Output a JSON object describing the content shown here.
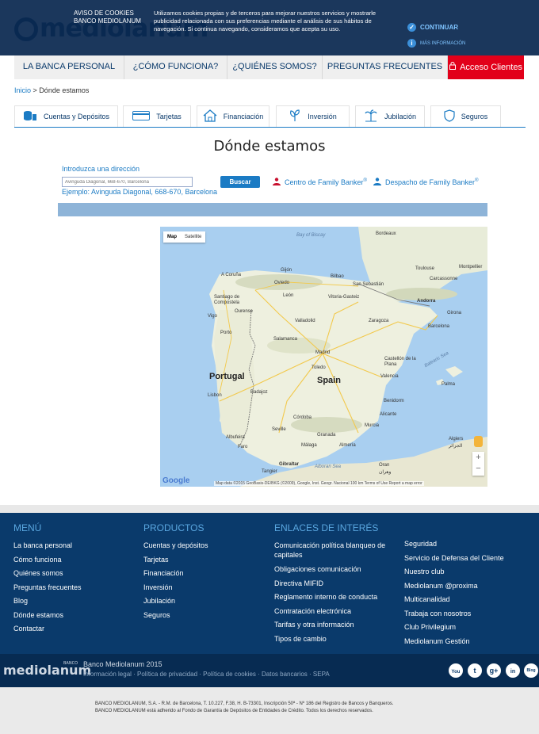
{
  "header": {
    "logo": "mediolanum"
  },
  "cookie": {
    "title_line1": "AVISO DE COOKIES",
    "title_line2": "BANCO MEDIOLANUM",
    "text": "Utilizamos cookies propias y de terceros para mejorar nuestros servicios y mostrarle publicidad relacionada con sus preferencias mediante el análisis de sus hábitos de navegación. Si continua navegando, consideramos que acepta su uso.",
    "continue": "CONTINUAR",
    "more_info": "MÁS INFORMACIÓN"
  },
  "nav": {
    "items": [
      "LA BANCA PERSONAL",
      "¿CÓMO FUNCIONA?",
      "¿QUIÉNES SOMOS?",
      "PREGUNTAS FRECUENTES"
    ],
    "acceso": "Acceso Clientes"
  },
  "breadcrumb": {
    "home": "Inicio",
    "sep": ">",
    "current": "Dónde estamos"
  },
  "tabs": [
    "Cuentas y Depósitos",
    "Tarjetas",
    "Financiación",
    "Inversión",
    "Jubilación",
    "Seguros"
  ],
  "page": {
    "title": "Dónde estamos"
  },
  "search": {
    "label": "Introduzca una dirección",
    "placeholder": "Avinguda Diagonal, 668-670, Barcelona",
    "example": "Ejemplo: Avinguda Diagonal, 668-670, Barcelona",
    "button": "Buscar",
    "legend_center": "Centro de Family Banker",
    "legend_office": "Despacho de Family Banker",
    "reg": "®"
  },
  "map": {
    "type_map": "Map",
    "type_satellite": "Satellite",
    "labels": {
      "bay": "Bay of Biscay",
      "bordeaux": "Bordeaux",
      "toulouse": "Toulouse",
      "montpellier": "Montpellier",
      "acoruna": "A Coruña",
      "gijon": "Gijón",
      "oviedo": "Oviedo",
      "bilbao": "Bilbao",
      "sansebastian": "San Sebastián",
      "carcassonne": "Carcassonne",
      "santiago": "Santiago de Compostela",
      "leon": "León",
      "vitoria": "Vitoria-Gasteiz",
      "andorra": "Andorra",
      "vigo": "Vigo",
      "ourense": "Ourense",
      "valladolid": "Valladolid",
      "zaragoza": "Zaragoza",
      "girona": "Girona",
      "porto": "Porto",
      "salamanca": "Salamanca",
      "barcelona": "Barcelona",
      "madrid": "Madrid",
      "toledo": "Toledo",
      "castellon": "Castellón de la Plana",
      "balearic": "Balearic Sea",
      "portugal": "Portugal",
      "spain": "Spain",
      "valencia": "Valencia",
      "palma": "Palma",
      "lisbon": "Lisbon",
      "badajoz": "Badajoz",
      "benidorm": "Benidorm",
      "alicante": "Alicante",
      "cordoba": "Córdoba",
      "murcia": "Murcia",
      "sevilla": "Seville",
      "granada": "Granada",
      "almeria": "Almería",
      "albufeira": "Albufeira",
      "faro": "Faro",
      "malaga": "Málaga",
      "algiers": "Algiers",
      "algiers_ar": "الجزائر",
      "gibraltar": "Gibraltar",
      "alboran": "Alboran Sea",
      "tangier": "Tangier",
      "oran": "Oran",
      "oran_ar": "وهران"
    },
    "zoom_in": "+",
    "zoom_out": "−",
    "google": "Google",
    "attribution": "Map data ©2015 GeoBasis-DE/BKG (©2009), Google, Inst. Geogr. Nacional   100 km   Terms of Use   Report a map error"
  },
  "footer": {
    "menu": {
      "title": "MENÚ",
      "links": [
        "La banca personal",
        "Cómo funciona",
        "Quiénes somos",
        "Preguntas frecuentes",
        "Blog",
        "Dónde estamos",
        "Contactar"
      ]
    },
    "products": {
      "title": "PRODUCTOS",
      "links": [
        "Cuentas y depósitos",
        "Tarjetas",
        "Financiación",
        "Inversión",
        "Jubilación",
        "Seguros"
      ]
    },
    "links": {
      "title": "ENLACES DE INTERÉS",
      "col1": [
        "Comunicación política blanqueo de capitales",
        "Obligaciones comunicación",
        "Directiva MIFID",
        "Reglamento interno de conducta",
        "Contratación electrónica",
        "Tarifas y otra información",
        "Tipos de cambio"
      ],
      "col2": [
        "Seguridad",
        "Servicio de Defensa del Cliente",
        "Nuestro club",
        "Mediolanum @proxima",
        "Multicanalidad",
        "Trabaja con nosotros",
        "Club Privilegium",
        "Mediolanum Gestión"
      ]
    },
    "logo": "mediolanum",
    "logo_small": "BANCO",
    "copyright": "Banco Mediolanum 2015",
    "legal_links": "Información legal · Política de privacidad · Política de cookies · Datos bancarios · SEPA",
    "social": [
      "You",
      "t",
      "g+",
      "in",
      "Blog"
    ],
    "legal_line1": "BANCO MEDIOLANUM, S.A. - R.M. de Barcelona, T. 10.227, F.38, H. B-73301, Inscripción 50ª - Nº 186 del Registro de Bancos y Banqueros.",
    "legal_line2": "BANCO MEDIOLANUM está adherido al Fondo de Garantía de Depósitos de Entidades de Crédito. Todos los derechos reservados."
  }
}
